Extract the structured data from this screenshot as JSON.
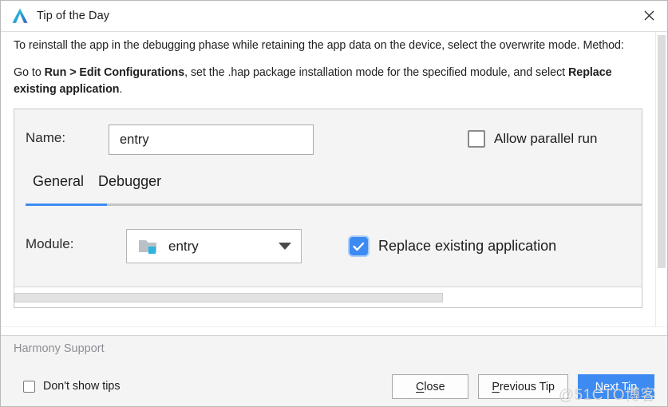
{
  "window": {
    "title": "Tip of the Day",
    "app_icon": "deveco-logo-icon",
    "close_icon": "close-icon"
  },
  "tip": {
    "paragraph1_pre": "To reinstall the app in the debugging phase while retaining the app data on the device, select the overwrite mode. Method:",
    "paragraph2_a": "Go to ",
    "paragraph2_b": "Run > Edit Configurations",
    "paragraph2_c": ", set the .hap package installation mode for the specified module, and select ",
    "paragraph2_d": "Replace existing application",
    "paragraph2_e": "."
  },
  "embedded": {
    "name_label": "Name:",
    "name_value": "entry",
    "allow_parallel_run_label": "Allow parallel run",
    "allow_parallel_run_checked": false,
    "tabs": [
      {
        "label": "General",
        "active": true
      },
      {
        "label": "Debugger",
        "active": false
      }
    ],
    "module_label": "Module:",
    "module_value": "entry",
    "module_icon": "module-folder-icon",
    "module_caret_icon": "chevron-down-icon",
    "replace_existing_label": "Replace existing application",
    "replace_existing_checked": true,
    "check_icon": "check-icon"
  },
  "footer": {
    "section_title": "Harmony Support",
    "dont_show_tips_label": "Don't show tips",
    "dont_show_tips_checked": false,
    "buttons": [
      {
        "label": "Close",
        "mnemonic": "C",
        "rest": "lose",
        "primary": false
      },
      {
        "label": "Previous Tip",
        "mnemonic": "P",
        "rest": "revious Tip",
        "primary": false
      },
      {
        "label": "Next Tip",
        "mnemonic": "N",
        "rest": "ext Tip",
        "primary": true
      }
    ]
  },
  "watermark": "@51CTO博客",
  "colors": {
    "accent_blue": "#3d8bf2",
    "window_bg": "#ffffff",
    "footer_bg": "#f4f4f4",
    "embedded_bg": "#f4f4f4",
    "muted_text": "#8d8d95",
    "body_text": "#1e1e1e"
  }
}
